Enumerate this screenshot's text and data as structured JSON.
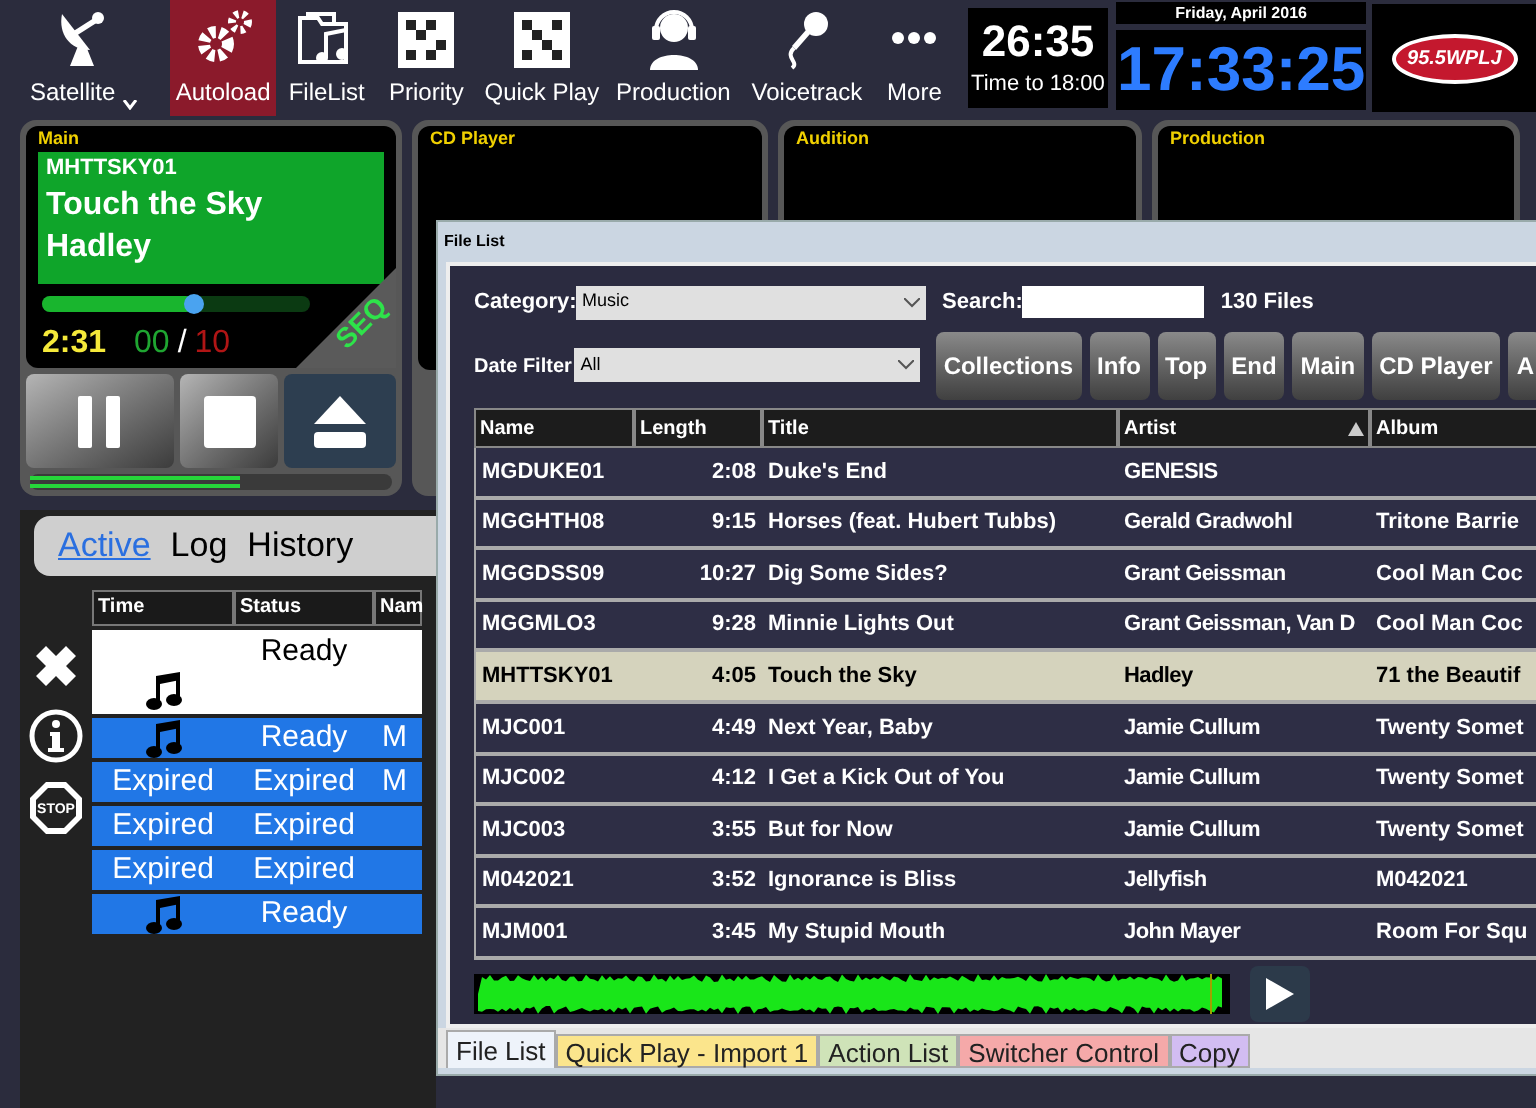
{
  "toolbar": {
    "items": [
      {
        "label": "Satellite",
        "selected": false
      },
      {
        "label": "Autoload",
        "selected": true
      },
      {
        "label": "FileList",
        "selected": false
      },
      {
        "label": "Priority",
        "selected": false
      },
      {
        "label": "Quick Play",
        "selected": false
      },
      {
        "label": "Production",
        "selected": false
      },
      {
        "label": "Voicetrack",
        "selected": false
      },
      {
        "label": "More",
        "selected": false
      }
    ],
    "countdown": {
      "time": "26:35",
      "label": "Time to 18:00"
    },
    "date": "Friday, April 2016",
    "clock": "17:33:25",
    "logo": "95.5WPLJ"
  },
  "players": [
    {
      "name": "Main",
      "cart": "MHTTSKY01",
      "title": "Touch the Sky",
      "artist": "Hadley",
      "progress": {
        "level": 0.57
      },
      "elapsed": "2:31",
      "count": "00",
      "separator": "/",
      "total": "10",
      "mode": "SEQ",
      "meter": {
        "level": 0.58
      }
    },
    {
      "name": "CD Player"
    },
    {
      "name": "Audition"
    },
    {
      "name": "Production"
    }
  ],
  "queue": {
    "tabs": [
      {
        "label": "Active",
        "selected": true
      },
      {
        "label": "Log",
        "selected": false
      },
      {
        "label": "History",
        "selected": false
      }
    ],
    "stop_label": "STOP",
    "columns": [
      "Time",
      "Status",
      "Nam"
    ],
    "rows": [
      {
        "kind": "note",
        "status": "Ready",
        "selected": true
      },
      {
        "kind": "note",
        "status": "Ready",
        "name": "M",
        "selected": false
      },
      {
        "kind": "text",
        "time": "Expired",
        "status": "Expired",
        "name": "M",
        "selected": false
      },
      {
        "kind": "text",
        "time": "Expired",
        "status": "Expired",
        "selected": false
      },
      {
        "kind": "text",
        "time": "Expired",
        "status": "Expired",
        "selected": false
      },
      {
        "kind": "note",
        "status": "Ready",
        "selected": false
      }
    ]
  },
  "file_list": {
    "title": "File List",
    "category": {
      "label": "Category:",
      "value": "Music"
    },
    "search": {
      "label": "Search:"
    },
    "count": "130 Files",
    "date_filter": {
      "label": "Date Filter",
      "value": "All"
    },
    "buttons": [
      "Collections",
      "Info",
      "Top",
      "End",
      "Main",
      "CD Player",
      "A"
    ],
    "columns": [
      {
        "label": "Name"
      },
      {
        "label": "Length"
      },
      {
        "label": "Title"
      },
      {
        "label": "Artist",
        "sorted": true
      },
      {
        "label": "Album"
      }
    ],
    "rows": [
      {
        "name": "MGDUKE01",
        "length": "2:08",
        "title": "Duke's End",
        "artist": "GENESIS",
        "selected": false
      },
      {
        "name": "MGGHTH08",
        "length": "9:15",
        "title": "Horses (feat. Hubert Tubbs)",
        "artist": "Gerald Gradwohl",
        "album": "Tritone Barrie",
        "selected": false
      },
      {
        "name": "MGGDSS09",
        "length": "10:27",
        "title": "Dig Some Sides?",
        "artist": "Grant Geissman",
        "album": "Cool Man Coc",
        "selected": false
      },
      {
        "name": "MGGMLO3",
        "length": "9:28",
        "title": "Minnie Lights Out",
        "artist": "Grant Geissman, Van D",
        "album": "Cool Man Coc",
        "selected": false
      },
      {
        "name": "MHTTSKY01",
        "length": "4:05",
        "title": "Touch the Sky",
        "artist": "Hadley",
        "album": "71 the Beautif",
        "selected": true
      },
      {
        "name": "MJC001",
        "length": "4:49",
        "title": "Next Year, Baby",
        "artist": "Jamie Cullum",
        "album": "Twenty Somet",
        "selected": false
      },
      {
        "name": "MJC002",
        "length": "4:12",
        "title": "I Get a Kick Out of You",
        "artist": "Jamie Cullum",
        "album": "Twenty Somet",
        "selected": false
      },
      {
        "name": "MJC003",
        "length": "3:55",
        "title": "But for Now",
        "artist": "Jamie Cullum",
        "album": "Twenty Somet",
        "selected": false
      },
      {
        "name": "M042021",
        "length": "3:52",
        "title": "Ignorance is Bliss",
        "artist": "Jellyfish",
        "album": "M042021",
        "selected": false
      },
      {
        "name": "MJM001",
        "length": "3:45",
        "title": "My Stupid Mouth",
        "artist": "John Mayer",
        "album": "Room For Squ",
        "selected": false
      }
    ],
    "tabs": [
      {
        "label": "File List",
        "selected": true,
        "color": "#eef3fa"
      },
      {
        "label": "Quick Play - Import 1",
        "selected": false,
        "color": "#fbe58c"
      },
      {
        "label": "Action List",
        "selected": false,
        "color": "#cfe3b8"
      },
      {
        "label": "Switcher Control",
        "selected": false,
        "color": "#f5a9a9"
      },
      {
        "label": "Copy",
        "selected": false,
        "color": "#d2bdf2"
      }
    ]
  }
}
